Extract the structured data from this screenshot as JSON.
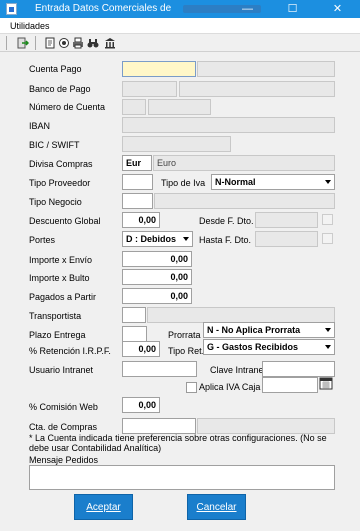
{
  "window": {
    "title": "Entrada Datos Comerciales de ",
    "minimize": "—",
    "maximize": "☐",
    "close": "✕"
  },
  "menu": {
    "utilidades": "Utilidades"
  },
  "toolbar": {
    "icons": [
      "exit-icon",
      "document-icon",
      "view-icon",
      "print-icon",
      "binoculars-icon",
      "bank-icon"
    ]
  },
  "fields": {
    "cuenta_pago": {
      "label": "Cuenta Pago",
      "value": "",
      "desc": ""
    },
    "banco_pago": {
      "label": "Banco de Pago"
    },
    "numero_cuenta": {
      "label": "Número de Cuenta"
    },
    "iban": {
      "label": "IBAN"
    },
    "bic": {
      "label": "BIC / SWIFT"
    },
    "divisa": {
      "label": "Divisa Compras",
      "code": "Eur",
      "desc": "Euro"
    },
    "tipo_proveedor": {
      "label": "Tipo Proveedor",
      "value": ""
    },
    "tipo_iva": {
      "label": "Tipo de Iva",
      "value": "N-Normal"
    },
    "tipo_negocio": {
      "label": "Tipo Negocio",
      "value": ""
    },
    "descuento_global": {
      "label": "Descuento Global",
      "value": "0,00"
    },
    "desde_dto": {
      "label": "Desde F. Dto."
    },
    "hasta_dto": {
      "label": "Hasta F. Dto."
    },
    "portes": {
      "label": "Portes",
      "value": "D : Debidos"
    },
    "importe_envio": {
      "label": "Importe x Envío",
      "value": "0,00"
    },
    "importe_bulto": {
      "label": "Importe x Bulto",
      "value": "0,00"
    },
    "pagados_partir": {
      "label": "Pagados a Partir",
      "value": "0,00"
    },
    "transportista": {
      "label": "Transportista",
      "value": ""
    },
    "plazo_entrega": {
      "label": "Plazo Entrega",
      "value": ""
    },
    "prorrata": {
      "label": "Prorrata",
      "value": "N - No Aplica Prorrata"
    },
    "retencion": {
      "label": "% Retención I.R.P.F.",
      "value": "0,00"
    },
    "tipo_ret": {
      "label": "Tipo Ret.",
      "value": "G - Gastos Recibidos"
    },
    "usuario_intranet": {
      "label": "Usuario Intranet",
      "value": ""
    },
    "clave_intranet": {
      "label": "Clave Intranet",
      "value": ""
    },
    "aplica_iva_caja": {
      "label": "Aplica IVA Caja",
      "checked": false
    },
    "comision_web": {
      "label": "% Comisión Web",
      "value": "0,00"
    },
    "cta_compras": {
      "label": "Cta. de Compras",
      "value": ""
    },
    "note": "* La Cuenta indicada tiene preferencia sobre otras configuraciones. (No se debe usar Contabilidad Analítica)",
    "mensaje_pedidos": {
      "label": "Mensaje Pedidos",
      "value": ""
    }
  },
  "buttons": {
    "aceptar": "Aceptar",
    "cancelar": "Cancelar"
  }
}
